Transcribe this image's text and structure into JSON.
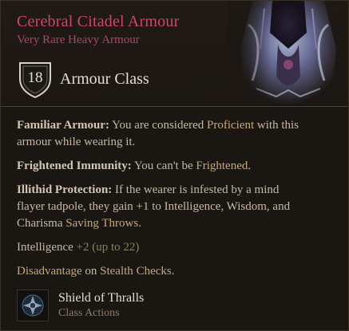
{
  "item": {
    "name": "Cerebral Citadel Armour",
    "rarity_type": "Very Rare Heavy Armour",
    "armour_class_value": "18",
    "armour_class_label": "Armour Class"
  },
  "properties": [
    {
      "name": "Familiar Armour:",
      "t1": " You are considered ",
      "h1": "Proficient",
      "t2": " with this armour while wearing it."
    },
    {
      "name": "Frightened Immunity:",
      "t1": " You can't be ",
      "h1": "Frightened",
      "t2": "."
    },
    {
      "name": "Illithid Protection:",
      "t1": " If the wearer is infested by a mind flayer tadpole, they gain +1 to Intelligence, Wisdom, and Charisma ",
      "h1": "Saving Throws",
      "t2": "."
    }
  ],
  "stat_bonus": {
    "stat": "Intelligence",
    "value": "+2",
    "cap": "(up to 22)"
  },
  "disadvantage": {
    "word": "Disadvantage",
    "on": " on ",
    "skill": "Stealth",
    "space": " ",
    "checks": "Checks",
    "end": "."
  },
  "action": {
    "name": "Shield of Thralls",
    "category": "Class Actions",
    "icon": "shield-of-thralls-icon"
  },
  "colors": {
    "title": "#d1446c",
    "subtitle": "#a84868",
    "highlight": "#c6a978",
    "bonus": "#7a8a56",
    "background": "#1a1612"
  }
}
